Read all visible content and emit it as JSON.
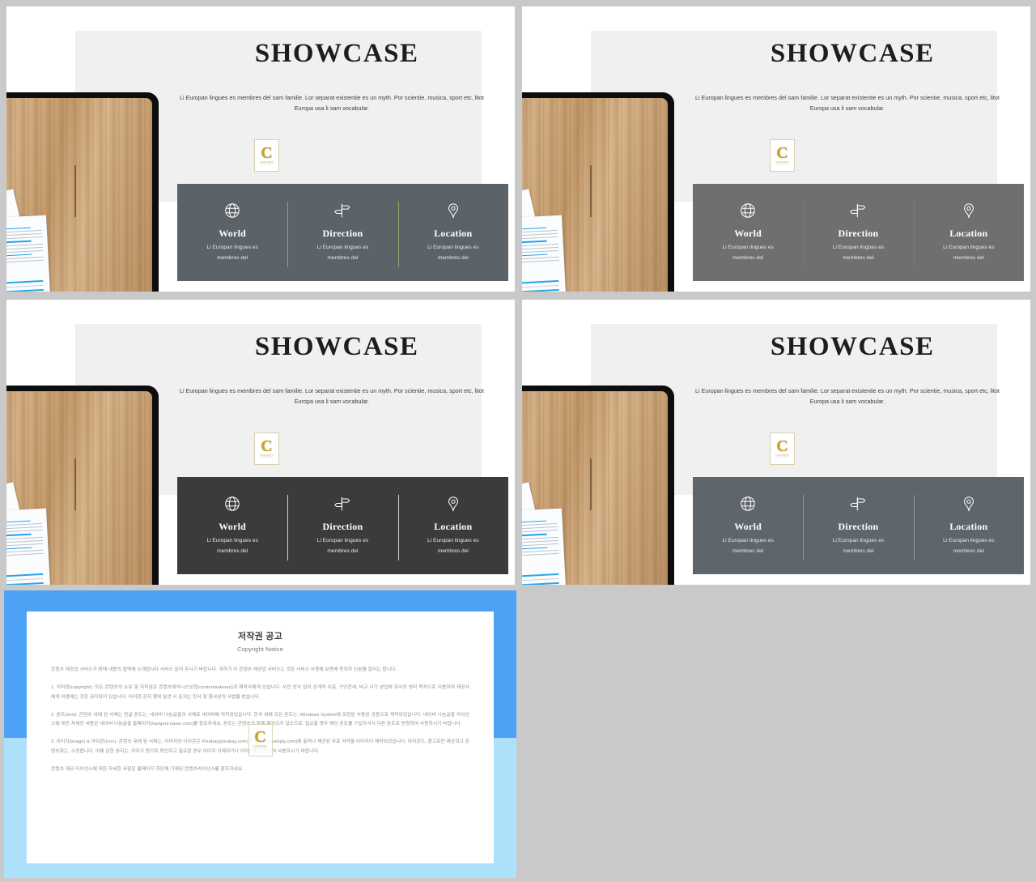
{
  "background_color": "#c9c9c9",
  "slides": [
    {
      "id": "slide-top-left",
      "title": "SHOWCASE",
      "subtitle": "Li Europan lingues es membres del sam familie. Lor separat existentie es un myth. Por scientie, musica, sport etc, litot Europa usa li sam vocabular.",
      "brand": {
        "letter": "C",
        "name": "CONCEPTS",
        "tagline": "WALL TEMP"
      },
      "infobar_color": "#5b6268",
      "divider_color": "#97a06a",
      "columns": [
        {
          "icon": "globe-icon",
          "label": "World",
          "desc": "Li Europan lingues es\nmembres del"
        },
        {
          "icon": "signpost-icon",
          "label": "Direction",
          "desc": "Li Europan lingues es\nmembres del"
        },
        {
          "icon": "location-pin-icon",
          "label": "Location",
          "desc": "Li Europan lingues es\nmembres del"
        }
      ]
    },
    {
      "id": "slide-top-right",
      "title": "SHOWCASE",
      "subtitle": "Li Europan lingues es membres del sam familie. Lor separat existentie es un myth. Por scientie, musica, sport etc, litot Europa usa li sam vocabular.",
      "brand": {
        "letter": "C",
        "name": "CONCEPTS",
        "tagline": "WALL TEMP"
      },
      "infobar_color": "#6f6f6f",
      "divider_color": "#7b7b7b",
      "columns": [
        {
          "icon": "globe-icon",
          "label": "World",
          "desc": "Li Europan lingues es\nmembres del"
        },
        {
          "icon": "signpost-icon",
          "label": "Direction",
          "desc": "Li Europan lingues es\nmembres del"
        },
        {
          "icon": "location-pin-icon",
          "label": "Location",
          "desc": "Li Europan lingues es\nmembres del"
        }
      ]
    },
    {
      "id": "slide-bottom-left",
      "title": "SHOWCASE",
      "subtitle": "Li Europan lingues es membres del sam familie. Lor separat existentie es un myth. Por scientie, musica, sport etc, litot Europa usa li sam vocabular.",
      "brand": {
        "letter": "C",
        "name": "CONCEPTS",
        "tagline": "WALL TEMP"
      },
      "infobar_color": "#3b3b3b",
      "divider_color": "#cfcfcf",
      "columns": [
        {
          "icon": "globe-icon",
          "label": "World",
          "desc": "Li Europan lingues es\nmembres del"
        },
        {
          "icon": "signpost-icon",
          "label": "Direction",
          "desc": "Li Europan lingues es\nmembres del"
        },
        {
          "icon": "location-pin-icon",
          "label": "Location",
          "desc": "Li Europan lingues es\nmembres del"
        }
      ]
    },
    {
      "id": "slide-bottom-right",
      "title": "SHOWCASE",
      "subtitle": "Li Europan lingues es membres del sam familie. Lor separat existentie es un myth. Por scientie, musica, sport etc, litot Europa usa li sam vocabular.",
      "brand": {
        "letter": "C",
        "name": "CONCEPTS",
        "tagline": "WALL TEMP"
      },
      "infobar_color": "#5e656b",
      "divider_color": "#9b8fb0",
      "columns": [
        {
          "icon": "globe-icon",
          "label": "World",
          "desc": "Li Europan lingues es\nmembres del"
        },
        {
          "icon": "signpost-icon",
          "label": "Direction",
          "desc": "Li Europan lingues es\nmembres del"
        },
        {
          "icon": "location-pin-icon",
          "label": "Location",
          "desc": "Li Europan lingues es\nmembres del"
        }
      ]
    }
  ],
  "copyright": {
    "frame_color_top": "#4da2f5",
    "frame_color_bottom": "#ace0fb",
    "title": "저작권 공고",
    "subtitle": "Copyright Notice",
    "brand": {
      "letter": "C",
      "name": "CONCEPTS",
      "tagline": "WALL TEMP"
    },
    "paragraphs": [
      "콘텐츠 제공업 서비스가 판매 내용의 협약에 소개됩니다 서비스 읽어 주시기 바랍니다. 귀하가 이 콘텐츠 제공업 서비스는 것은 서비스 사용에 보증에 동의하 신분을 알리는 합니다.",
      "1. 저작권(copyright): 모든 콘텐츠의 소유 및 저작권은 콘텐츠쉐어니스닷컴(contentsakeout)과 제작사에게 있습니다. 사전 승낙 없이 공개적 이윤, 구인전세, 비교 사기 상업에 회사의 영리 목적으로 이용하여 제공사에게 이용에는 것은 금지되어 있습니다. 이러한 공지 행위 발견 시 문의는 민사 및 형사상의 사법을 받습니다.",
      "2. 폰트(font): 콘텐츠 내에 된 서체는 한글 폰트는, 네이버 나눔글꼴의 서체로 네이버에 저작권있습니다. 한국 외에 모든 폰트는, Windows System에 포함된 사용된 공용으로 제작되었습니다. 네이버 나눔글꼴 라이선스에 대한 자세한 내용은 네이버 나눔글꼴 홈페이지(hangeul.naver.com)를 참조하세요. 폰트는 콘텐츠의 함께 제공되지 않으므로, 필요할 경우 해당 폰트를 구입하셔서 다른 폰트로 변경하여 사용하시기 바랍니다.",
      "3. 이미지(image) & 아이콘(icon): 콘텐츠 내에 된 서체는, 이미지와 아이콘은 Pixabay(pixabay.com)와 Webply(webply.com)에 출처나 제공된 무료 저작물 이미지이 제작되었습니다. 아이콘도, 참고로만 제공되고 콘텐츠화는, 수정합니다. 이에 관한 권리는, 귀하가 원므로 확인하고 필요할 경우 이미지 삭제하거나 이미지를 변경하여 사용하시기 바랍니다.",
      "콘텐츠 제공 라이선스에 대한 자세한 사항은 홈페이지 하단에 기재된 콘텐츠라이선스를 참조하세요."
    ]
  }
}
